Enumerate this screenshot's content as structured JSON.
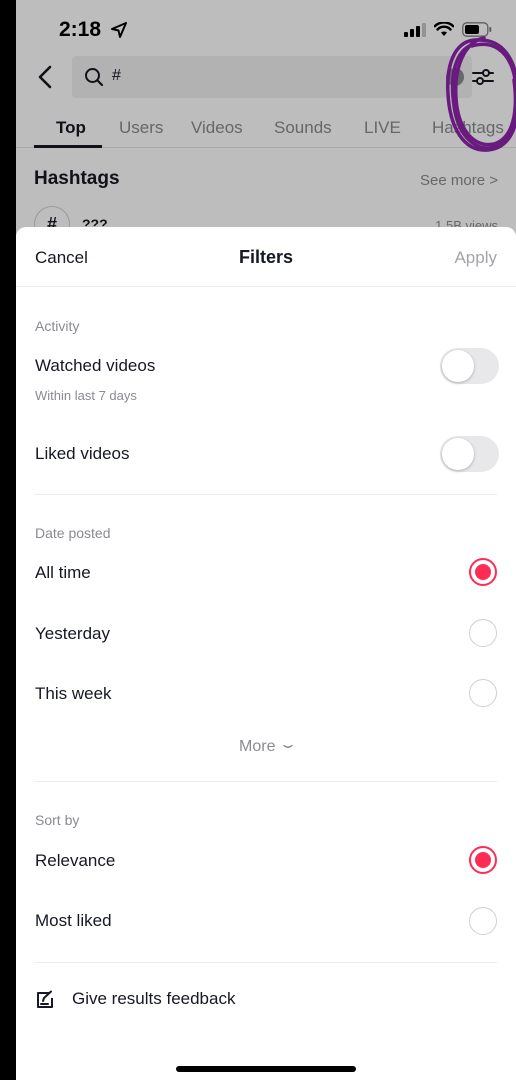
{
  "status_bar": {
    "time": "2:18"
  },
  "search": {
    "query": "#"
  },
  "tabs": [
    {
      "label": "Top",
      "active": true
    },
    {
      "label": "Users"
    },
    {
      "label": "Videos"
    },
    {
      "label": "Sounds"
    },
    {
      "label": "LIVE"
    },
    {
      "label": "Hashtags"
    }
  ],
  "hashtags": {
    "title": "Hashtags",
    "see_more": "See more >",
    "item": {
      "symbol": "#",
      "name": "???",
      "views": "1.5B views"
    }
  },
  "annotation": {
    "scribble_color": "#8e24aa"
  },
  "filters": {
    "cancel": "Cancel",
    "title": "Filters",
    "apply": "Apply",
    "activity": {
      "label": "Activity",
      "watched": {
        "label": "Watched videos",
        "sub": "Within last 7 days",
        "on": false
      },
      "liked": {
        "label": "Liked videos",
        "on": false
      }
    },
    "date_posted": {
      "label": "Date posted",
      "options": [
        "All time",
        "Yesterday",
        "This week"
      ],
      "selected": "All time",
      "more": "More"
    },
    "sort_by": {
      "label": "Sort by",
      "options": [
        "Relevance",
        "Most liked"
      ],
      "selected": "Relevance"
    },
    "feedback": "Give results feedback"
  },
  "colors": {
    "accent": "#fe2c55",
    "text": "#161823",
    "muted": "#8a8b91"
  }
}
